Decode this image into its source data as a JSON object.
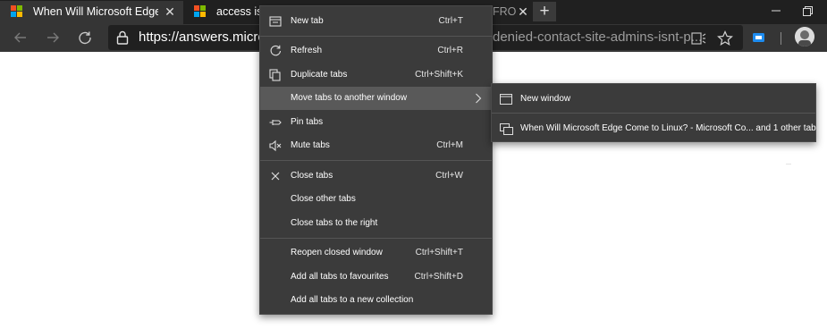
{
  "tabs": [
    {
      "title": "When Will Microsoft Edge Come to Linux?",
      "close": "✕",
      "logo": "microsoft-logo"
    },
    {
      "title": "access is denied",
      "close": "✕",
      "logo": "microsoft-logo"
    },
    {
      "title": "FRO",
      "close": "✕"
    }
  ],
  "toolbar": {
    "url_left": "https://answers.microso",
    "url_right": "denied-contact-site-admins-isnt-p..."
  },
  "context_menu": {
    "items": [
      {
        "label": "New tab",
        "shortcut": "Ctrl+T",
        "icon": "new-tab-icon"
      },
      {
        "label": "Refresh",
        "shortcut": "Ctrl+R",
        "icon": "refresh-icon"
      },
      {
        "label": "Duplicate tabs",
        "shortcut": "Ctrl+Shift+K",
        "icon": "duplicate-icon"
      },
      {
        "label": "Move tabs to another window",
        "shortcut": "",
        "icon": "chevron-right-icon"
      },
      {
        "label": "Pin tabs",
        "shortcut": "",
        "icon": "pin-icon"
      },
      {
        "label": "Mute tabs",
        "shortcut": "Ctrl+M",
        "icon": "mute-icon"
      },
      {
        "label": "Close tabs",
        "shortcut": "Ctrl+W",
        "icon": "close-icon"
      },
      {
        "label": "Close other tabs",
        "shortcut": ""
      },
      {
        "label": "Close tabs to the right",
        "shortcut": ""
      },
      {
        "label": "Reopen closed window",
        "shortcut": "Ctrl+Shift+T"
      },
      {
        "label": "Add all tabs to favourites",
        "shortcut": "Ctrl+Shift+D"
      },
      {
        "label": "Add all tabs to a new collection",
        "shortcut": ""
      }
    ]
  },
  "submenu": {
    "items": [
      {
        "label": "New window",
        "icon": "window-icon"
      },
      {
        "label": "When Will Microsoft Edge Come to Linux? - Microsoft Co... and 1 other tab",
        "icon": "windows-stack-icon"
      }
    ]
  },
  "colors": {
    "tabstrip": "#202020",
    "toolbar": "#353535",
    "menu_bg": "#3b3b3b",
    "menu_highlight": "#595959"
  }
}
